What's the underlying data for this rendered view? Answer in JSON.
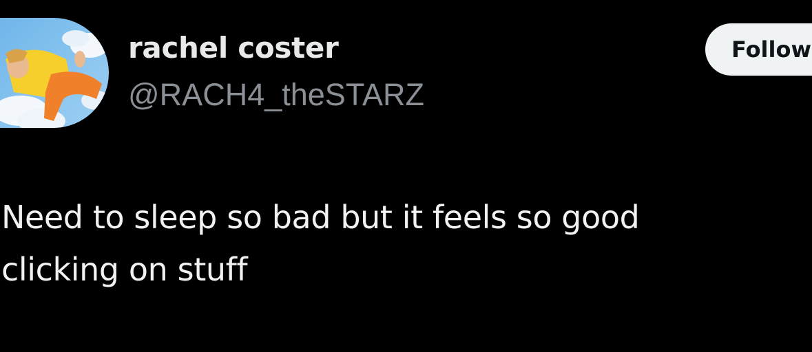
{
  "tweet": {
    "author": {
      "display_name": "rachel coster",
      "handle": "@RACH4_theSTARZ",
      "avatar_icon": "profile-avatar"
    },
    "follow_label": "Follow",
    "text_lines": [
      "Need to sleep so bad but it feels so good",
      "clicking on stuff"
    ]
  },
  "colors": {
    "background": "#000000",
    "primary_text": "#e7e9ea",
    "secondary_text": "#8b9096",
    "button_bg": "#eff3f4",
    "button_text": "#0f1419"
  }
}
